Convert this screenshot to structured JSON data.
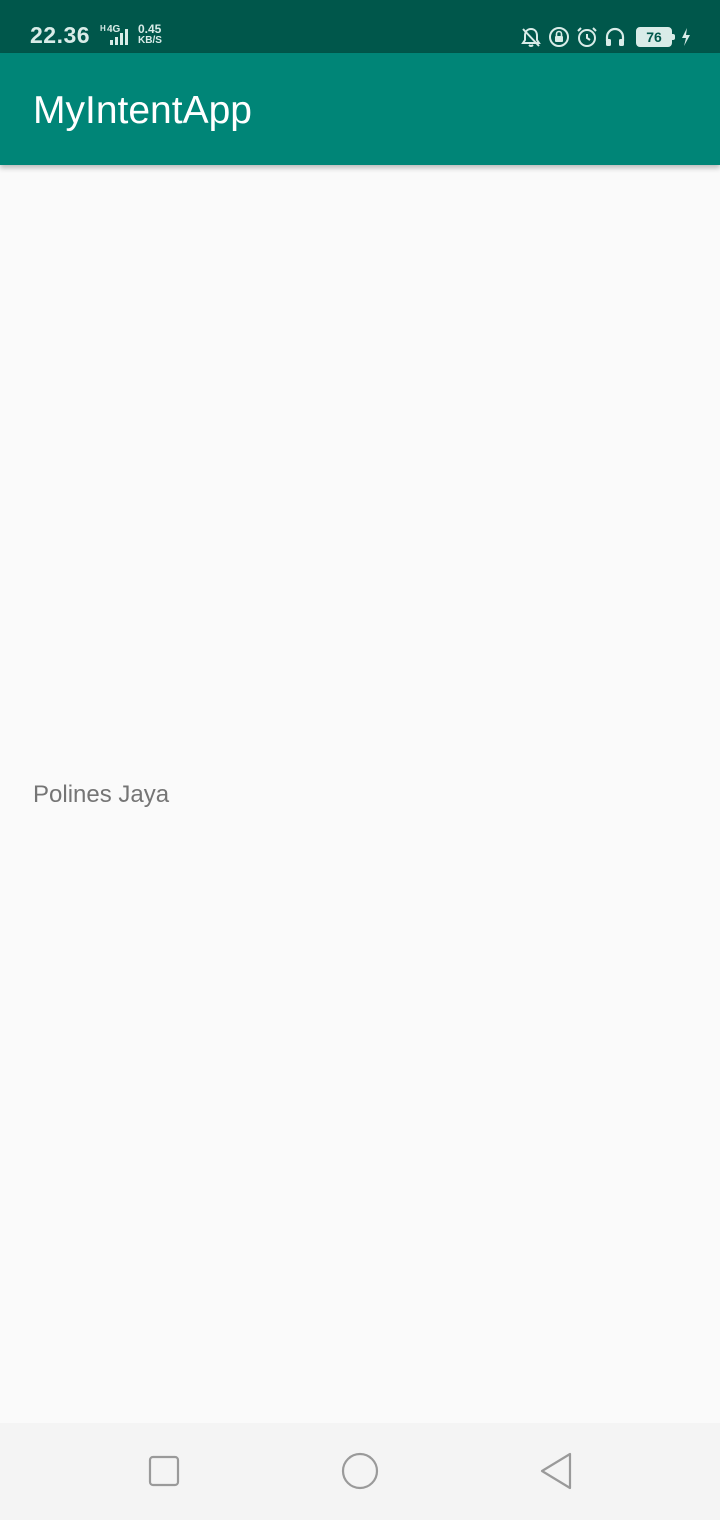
{
  "status_bar": {
    "time": "22.36",
    "network_type": "H",
    "network_gen": "4G",
    "speed_value": "0.45",
    "speed_unit": "KB/S",
    "battery_level": "76",
    "icons": [
      "signal-icon",
      "silent-bell-icon",
      "rotation-lock-icon",
      "alarm-icon",
      "headphones-icon",
      "battery-icon",
      "charging-icon"
    ]
  },
  "app_bar": {
    "title": "MyIntentApp"
  },
  "content": {
    "text": "Polines Jaya"
  },
  "nav_bar": {
    "icons": [
      "recent-apps-icon",
      "home-icon",
      "back-icon"
    ]
  },
  "colors": {
    "status_bar": "#00574b",
    "app_bar": "#008577",
    "background": "#fafafa",
    "content_text": "#757575"
  }
}
